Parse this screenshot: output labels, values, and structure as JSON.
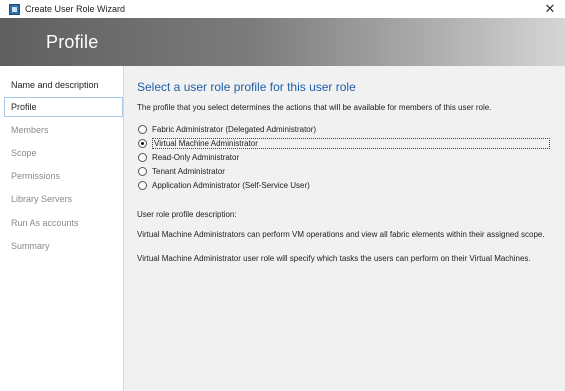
{
  "window": {
    "title": "Create User Role Wizard",
    "close_label": "✕"
  },
  "banner": {
    "title": "Profile"
  },
  "sidebar": {
    "items": [
      {
        "label": "Name and description",
        "state": "done"
      },
      {
        "label": "Profile",
        "state": "active"
      },
      {
        "label": "Members",
        "state": "pending"
      },
      {
        "label": "Scope",
        "state": "pending"
      },
      {
        "label": "Permissions",
        "state": "pending"
      },
      {
        "label": "Library Servers",
        "state": "pending"
      },
      {
        "label": "Run As accounts",
        "state": "pending"
      },
      {
        "label": "Summary",
        "state": "pending"
      }
    ]
  },
  "main": {
    "heading": "Select a user role profile for this user role",
    "intro": "The profile that you select determines the actions that will be available for members of this user role.",
    "options": [
      {
        "label": "Fabric Administrator (Delegated Administrator)",
        "checked": false
      },
      {
        "label": "Virtual Machine Administrator",
        "checked": true
      },
      {
        "label": "Read-Only Administrator",
        "checked": false
      },
      {
        "label": "Tenant Administrator",
        "checked": false
      },
      {
        "label": "Application Administrator (Self-Service User)",
        "checked": false
      }
    ],
    "description_label": "User role profile description:",
    "description_line1": "Virtual Machine Administrators can perform VM operations and view all fabric elements within their assigned scope.",
    "description_line2": "Virtual Machine Administrator user role will specify which tasks the users can perform on their Virtual Machines."
  },
  "colors": {
    "accent": "#1f5fa8",
    "banner_dark": "#5f5f5f",
    "content_bg": "#f1f1f1",
    "selection_border": "#a9c7e6"
  }
}
